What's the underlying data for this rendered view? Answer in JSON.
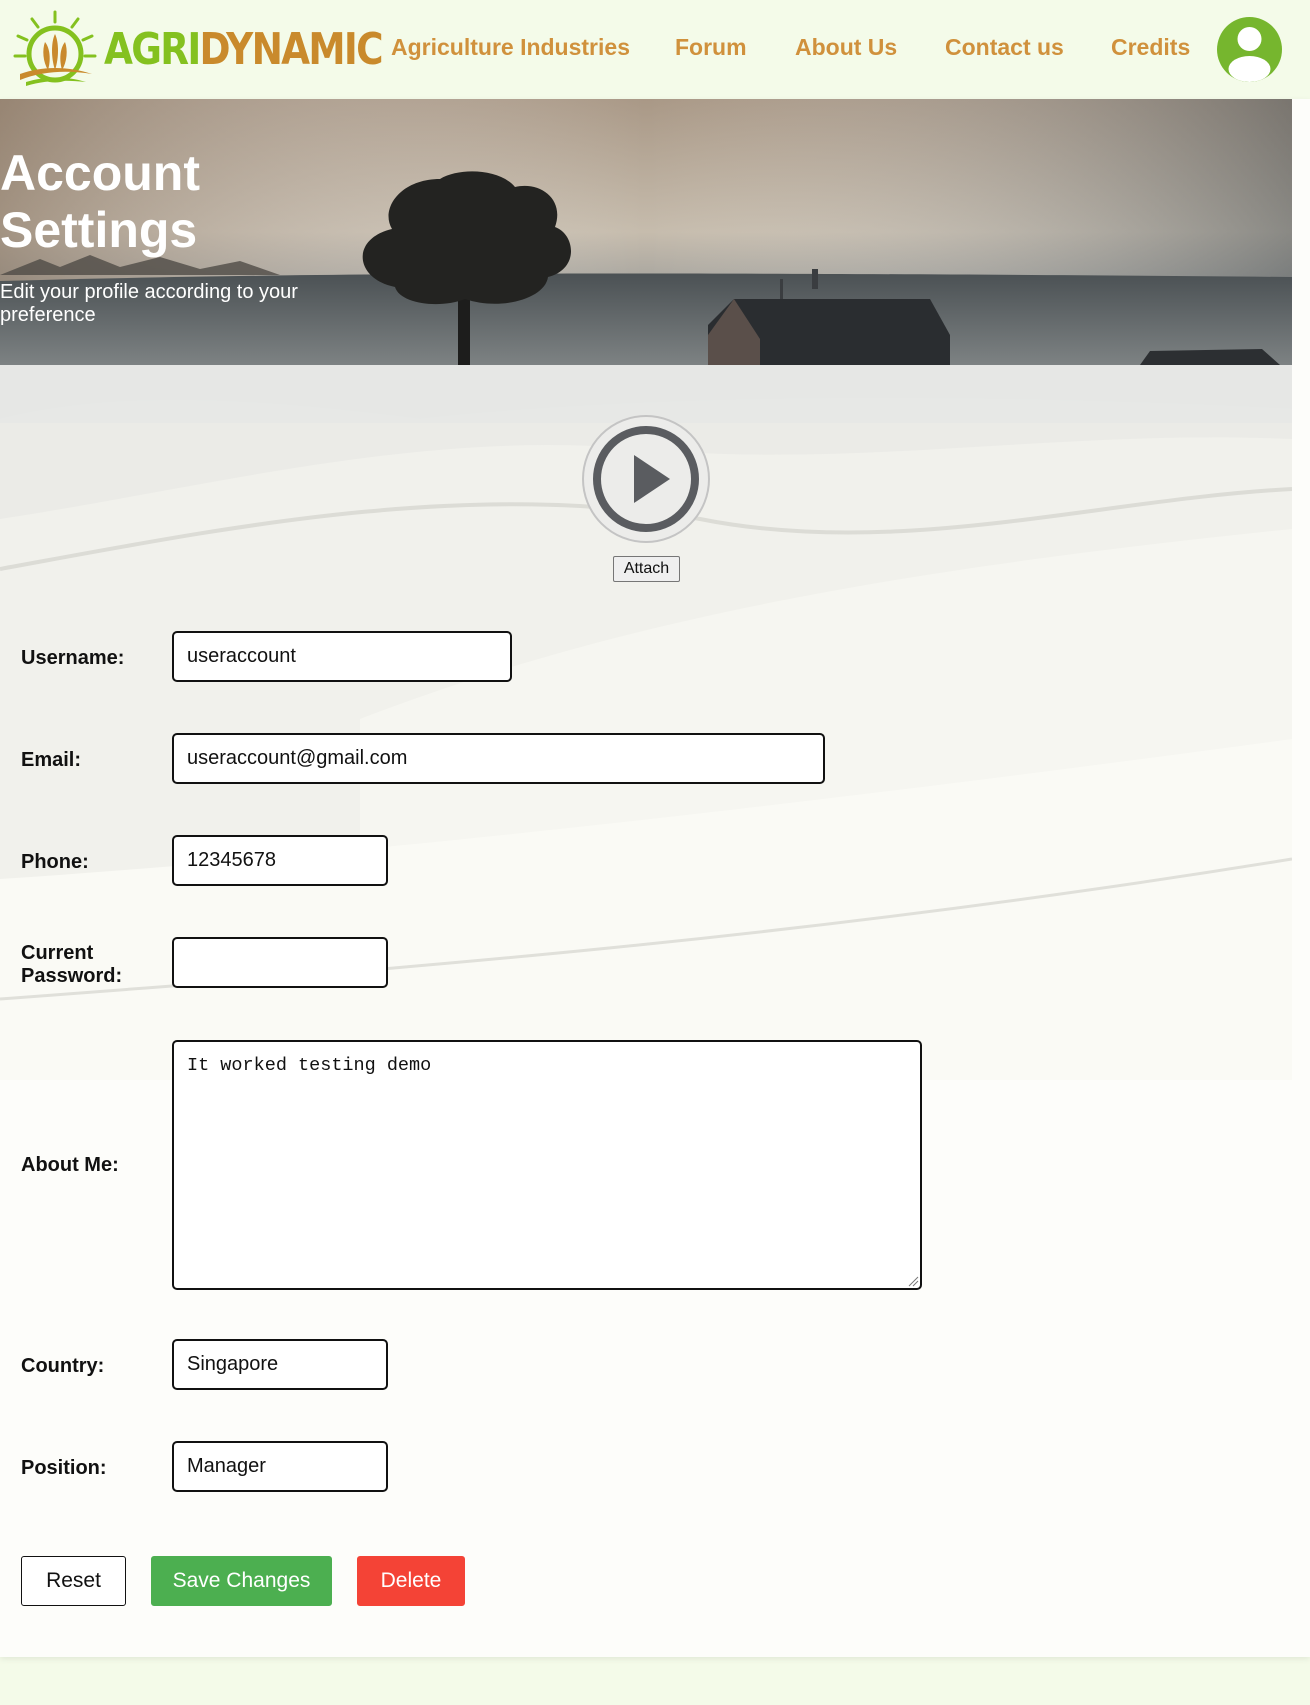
{
  "brand": {
    "name_part1": "AGRI",
    "name_part2": "DYNAMIC",
    "colors": {
      "green": "#84c11f",
      "gold": "#c98a2c"
    }
  },
  "nav": {
    "items": [
      {
        "label": "Agriculture Industries"
      },
      {
        "label": "Forum"
      },
      {
        "label": "About Us"
      },
      {
        "label": "Contact us"
      },
      {
        "label": "Credits"
      }
    ],
    "link_color": "#d0913c",
    "profile_icon": "user-avatar-icon",
    "avatar_color": "#76b62e"
  },
  "hero": {
    "title": "Account Settings",
    "subtitle": "Edit your profile according to your preference"
  },
  "media": {
    "icon": "play-circle-icon",
    "attach_label": "Attach"
  },
  "form": {
    "username": {
      "label": "Username:",
      "value": "useraccount"
    },
    "email": {
      "label": "Email:",
      "value": "useraccount@gmail.com"
    },
    "phone": {
      "label": "Phone:",
      "value": "12345678"
    },
    "current_password": {
      "label_line1": "Current",
      "label_line2": "Password:",
      "value": ""
    },
    "about": {
      "label": "About Me:",
      "value": "It worked testing demo"
    },
    "country": {
      "label": "Country:",
      "value": "Singapore"
    },
    "position": {
      "label": "Position:",
      "value": "Manager"
    }
  },
  "actions": {
    "reset_label": "Reset",
    "save_label": "Save Changes",
    "delete_label": "Delete",
    "save_color": "#4caf50",
    "delete_color": "#f44336"
  }
}
